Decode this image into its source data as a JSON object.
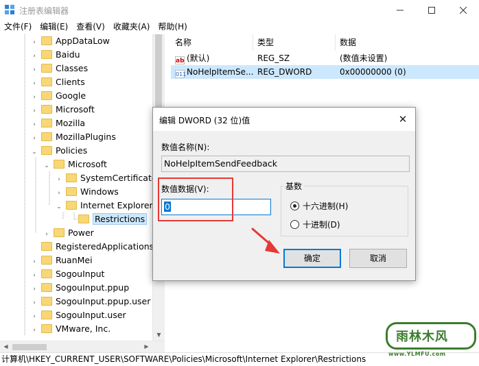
{
  "window": {
    "title": "注册表编辑器"
  },
  "menu": [
    "文件(F)",
    "编辑(E)",
    "查看(V)",
    "收藏夹(A)",
    "帮助(H)"
  ],
  "tree": [
    {
      "label": "AppDataLow",
      "expander": "›"
    },
    {
      "label": "Baidu",
      "expander": "›"
    },
    {
      "label": "Classes",
      "expander": "›"
    },
    {
      "label": "Clients",
      "expander": "›"
    },
    {
      "label": "Google",
      "expander": "›"
    },
    {
      "label": "Microsoft",
      "expander": "›"
    },
    {
      "label": "Mozilla",
      "expander": "›"
    },
    {
      "label": "MozillaPlugins",
      "expander": "›"
    },
    {
      "label": "Policies",
      "expander": "⌄"
    },
    {
      "label": "Microsoft",
      "expander": "⌄"
    },
    {
      "label": "SystemCertificates",
      "expander": "›"
    },
    {
      "label": "Windows",
      "expander": "›"
    },
    {
      "label": "Internet Explorer",
      "expander": "⌄"
    },
    {
      "label": "Restrictions",
      "expander": ""
    },
    {
      "label": "Power",
      "expander": "›"
    },
    {
      "label": "RegisteredApplications",
      "expander": ""
    },
    {
      "label": "RuanMei",
      "expander": "›"
    },
    {
      "label": "SogouInput",
      "expander": "›"
    },
    {
      "label": "SogouInput.ppup",
      "expander": "›"
    },
    {
      "label": "SogouInput.ppup.user",
      "expander": "›"
    },
    {
      "label": "SogouInput.user",
      "expander": "›"
    },
    {
      "label": "VMware, Inc.",
      "expander": "›"
    }
  ],
  "list": {
    "headers": {
      "name": "名称",
      "type": "类型",
      "data": "数据"
    },
    "rows": [
      {
        "icon": "ab",
        "name": "(默认)",
        "type": "REG_SZ",
        "data": "(数值未设置)"
      },
      {
        "icon": "011",
        "name": "NoHelpItemSe...",
        "type": "REG_DWORD",
        "data": "0x00000000 (0)"
      }
    ]
  },
  "statusbar": {
    "path": "计算机\\HKEY_CURRENT_USER\\SOFTWARE\\Policies\\Microsoft\\Internet Explorer\\Restrictions"
  },
  "dialog": {
    "title": "编辑 DWORD (32 位)值",
    "close": "✕",
    "name_label": "数值名称(N):",
    "name_value": "NoHelpItemSendFeedback",
    "data_label": "数值数据(V):",
    "data_value": "0",
    "base_label": "基数",
    "hex_label": "十六进制(H)",
    "dec_label": "十进制(D)",
    "ok": "确定",
    "cancel": "取消"
  },
  "watermark": {
    "brand": "雨林木风",
    "url": "www.YLMFU.com"
  },
  "colors": {
    "selection": "#cce8ff",
    "accent": "#0078d7",
    "annotation": "#e53935",
    "watermark": "#3a7d2c"
  }
}
